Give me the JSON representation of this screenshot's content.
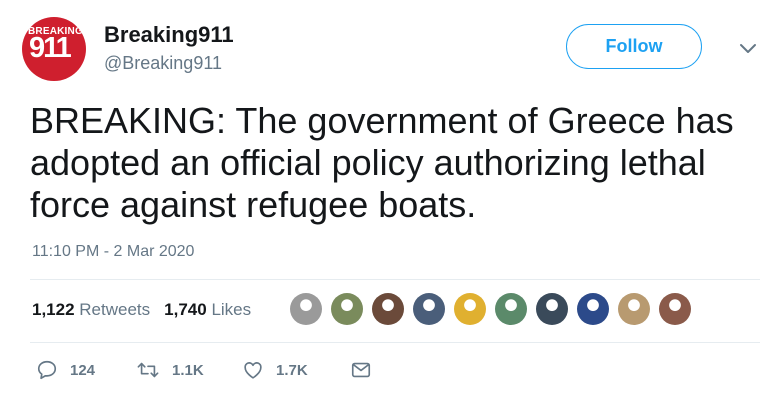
{
  "account": {
    "display_name": "Breaking911",
    "handle": "@Breaking911",
    "avatar_top_text": "BREAKING",
    "avatar_main_text": "911",
    "avatar_color": "#cf1f2e"
  },
  "follow_button": {
    "label": "Follow",
    "color": "#1da1f2"
  },
  "tweet": {
    "text": "BREAKING: The government of Greece has\nadopted an official policy authorizing lethal\nforce against refugee boats.",
    "timestamp": "11:10 PM - 2 Mar 2020"
  },
  "stats": {
    "retweets_count": "1,122",
    "retweets_label": "Retweets",
    "likes_count": "1,740",
    "likes_label": "Likes"
  },
  "likers": [
    {
      "name": "liker-avatar-1",
      "color": "#9a9a9a"
    },
    {
      "name": "liker-avatar-2",
      "color": "#7a8b5c"
    },
    {
      "name": "liker-avatar-3",
      "color": "#6b4a3a"
    },
    {
      "name": "liker-avatar-4",
      "color": "#4a5e7a"
    },
    {
      "name": "liker-avatar-5",
      "color": "#e0b030"
    },
    {
      "name": "liker-avatar-6",
      "color": "#5b8a6a"
    },
    {
      "name": "liker-avatar-7",
      "color": "#3a4a5a"
    },
    {
      "name": "liker-avatar-8",
      "color": "#2c4a8a"
    },
    {
      "name": "liker-avatar-9",
      "color": "#b89a70"
    },
    {
      "name": "liker-avatar-10",
      "color": "#8a5a4a"
    }
  ],
  "actions": {
    "replies": "124",
    "retweets": "1.1K",
    "likes": "1.7K"
  },
  "icons": {
    "chevron": "chevron-down-icon",
    "reply": "reply-icon",
    "retweet": "retweet-icon",
    "like": "heart-icon",
    "message": "envelope-icon"
  }
}
